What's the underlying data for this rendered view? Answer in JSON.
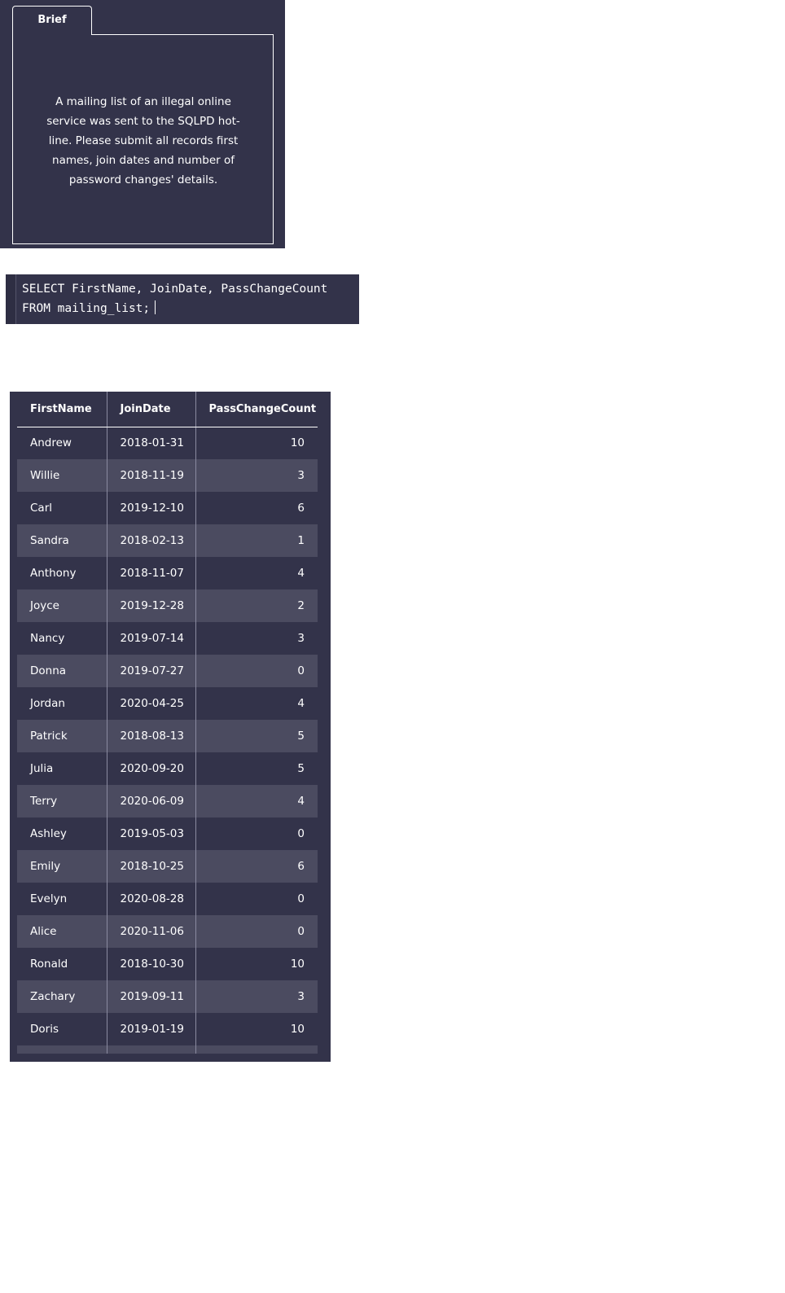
{
  "brief": {
    "tab_label": "Brief",
    "text": "A mailing list of an illegal online service was sent to the SQLPD hot-line. Please submit all records first names, join dates and number of password changes' details."
  },
  "editor": {
    "line1": "SELECT FirstName, JoinDate, PassChangeCount",
    "line2": "FROM mailing_list;"
  },
  "results": {
    "columns": [
      "FirstName",
      "JoinDate",
      "PassChangeCount"
    ],
    "rows": [
      [
        "Andrew",
        "2018-01-31",
        "10"
      ],
      [
        "Willie",
        "2018-11-19",
        "3"
      ],
      [
        "Carl",
        "2019-12-10",
        "6"
      ],
      [
        "Sandra",
        "2018-02-13",
        "1"
      ],
      [
        "Anthony",
        "2018-11-07",
        "4"
      ],
      [
        "Joyce",
        "2019-12-28",
        "2"
      ],
      [
        "Nancy",
        "2019-07-14",
        "3"
      ],
      [
        "Donna",
        "2019-07-27",
        "0"
      ],
      [
        "Jordan",
        "2020-04-25",
        "4"
      ],
      [
        "Patrick",
        "2018-08-13",
        "5"
      ],
      [
        "Julia",
        "2020-09-20",
        "5"
      ],
      [
        "Terry",
        "2020-06-09",
        "4"
      ],
      [
        "Ashley",
        "2019-05-03",
        "0"
      ],
      [
        "Emily",
        "2018-10-25",
        "6"
      ],
      [
        "Evelyn",
        "2020-08-28",
        "0"
      ],
      [
        "Alice",
        "2020-11-06",
        "0"
      ],
      [
        "Ronald",
        "2018-10-30",
        "10"
      ],
      [
        "Zachary",
        "2019-09-11",
        "3"
      ],
      [
        "Doris",
        "2019-01-19",
        "10"
      ]
    ]
  }
}
